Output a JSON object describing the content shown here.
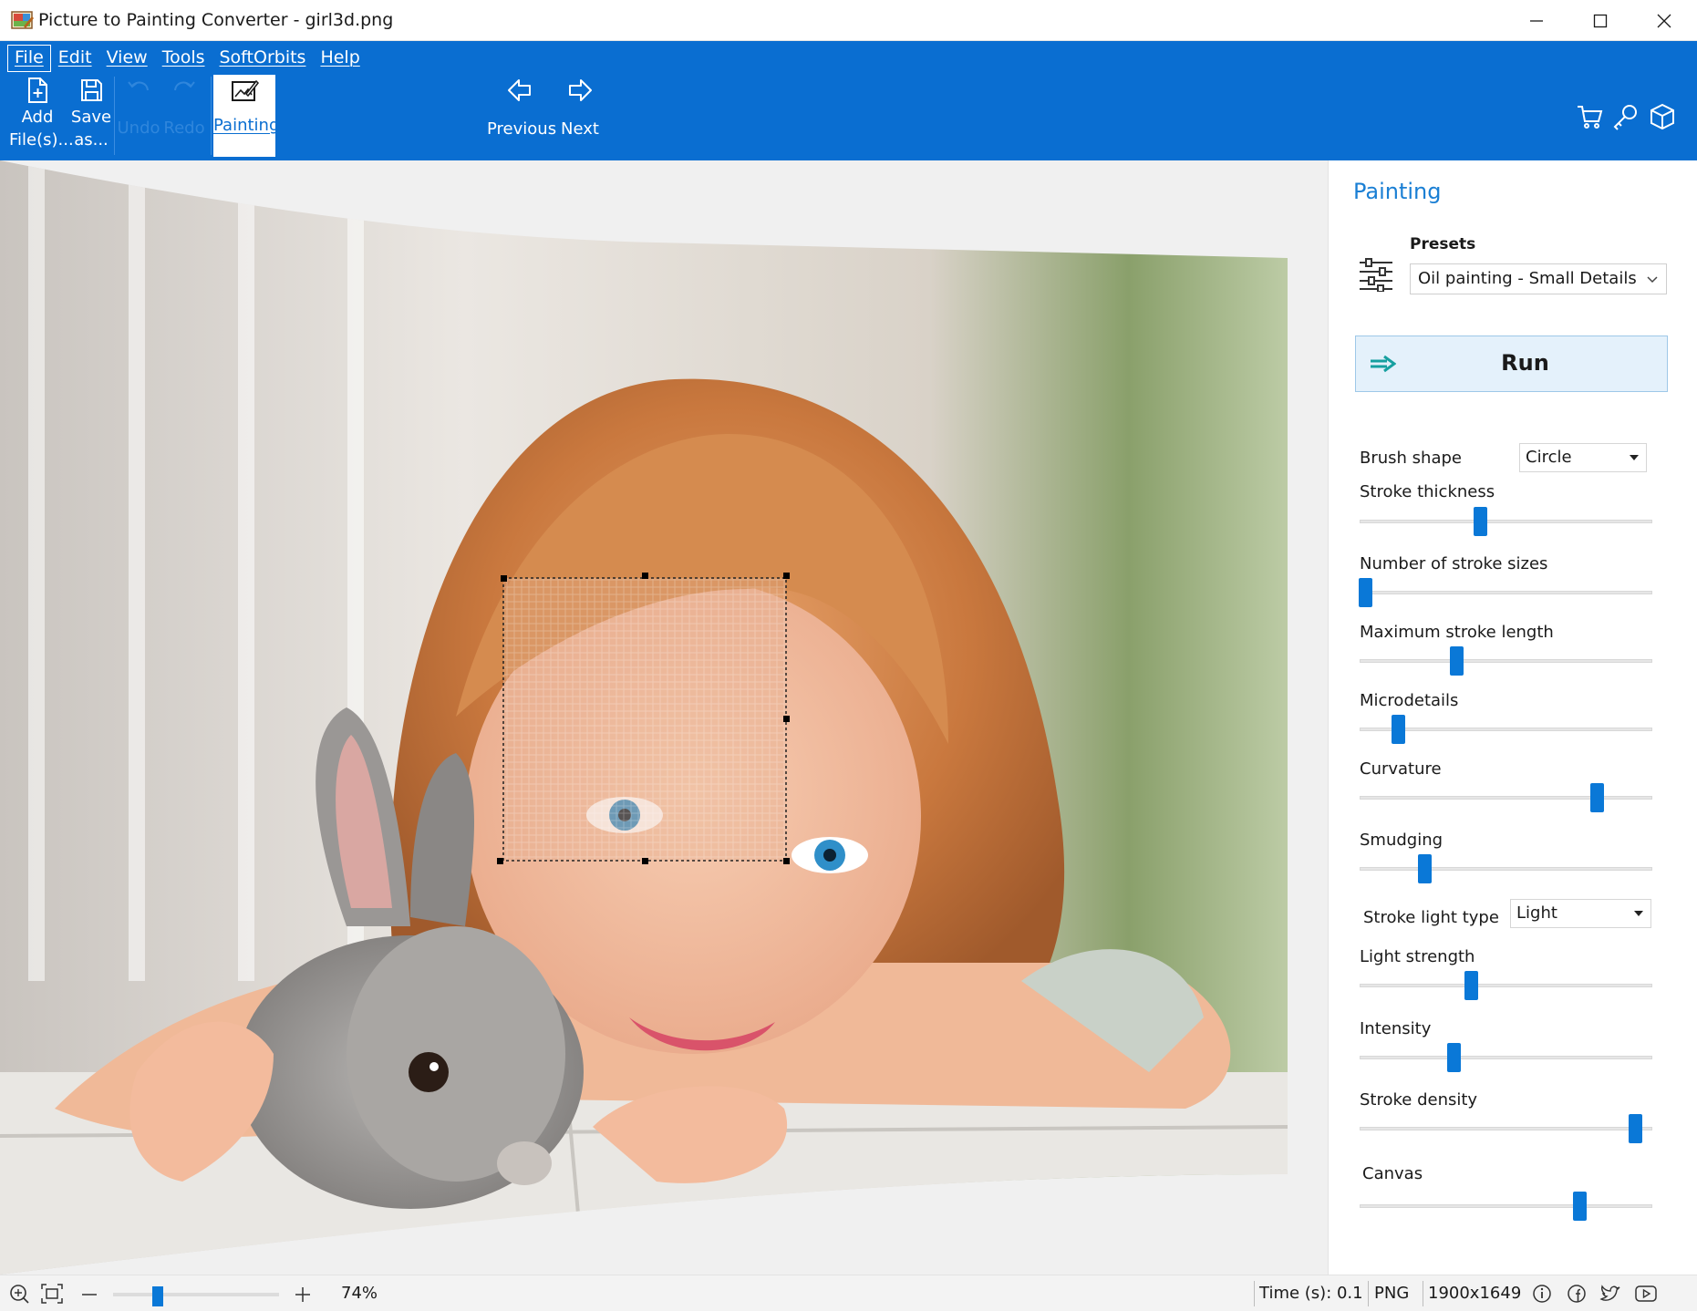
{
  "window": {
    "title": "Picture to Painting Converter - girl3d.png"
  },
  "menu": {
    "items": [
      {
        "label": "File",
        "active": true
      },
      {
        "label": "Edit",
        "active": false
      },
      {
        "label": "View",
        "active": false
      },
      {
        "label": "Tools",
        "active": false
      },
      {
        "label": "SoftOrbits",
        "active": false
      },
      {
        "label": "Help",
        "active": false
      }
    ]
  },
  "toolbar": {
    "add_line1": "Add",
    "add_line2": "File(s)...",
    "save_line1": "Save",
    "save_line2": "as...",
    "undo_label": "Undo",
    "redo_label": "Redo",
    "painting_label": "Painting",
    "previous_label": "Previous",
    "next_label": "Next"
  },
  "panel": {
    "title": "Painting",
    "presets_label": "Presets",
    "presets_value": "Oil painting - Small Details",
    "run_label": "Run",
    "brush_shape_label": "Brush shape",
    "brush_shape_value": "Circle",
    "stroke_light_type_label": "Stroke light type",
    "stroke_light_type_value": "Light",
    "sliders": [
      {
        "label": "Stroke thickness",
        "value": 0.41
      },
      {
        "label": "Number of stroke sizes",
        "value": 0.02
      },
      {
        "label": "Maximum stroke length",
        "value": 0.33
      },
      {
        "label": "Microdetails",
        "value": 0.13
      },
      {
        "label": "Curvature",
        "value": 0.81
      },
      {
        "label": "Smudging",
        "value": 0.22
      },
      {
        "label": "Light strength",
        "value": 0.38
      },
      {
        "label": "Intensity",
        "value": 0.32
      },
      {
        "label": "Stroke density",
        "value": 0.94
      },
      {
        "label": "Canvas",
        "value": 0.75
      }
    ]
  },
  "status": {
    "zoom_level": "74%",
    "zoom_value": 0.27,
    "time": "Time (s): 0.1",
    "format": "PNG",
    "dimensions": "1900x1649"
  },
  "colors": {
    "ribbon": "#0a6ed1",
    "accent": "#1a7fd4",
    "slider_thumb": "#0a78d7",
    "run_button": "#e4f1fb"
  }
}
